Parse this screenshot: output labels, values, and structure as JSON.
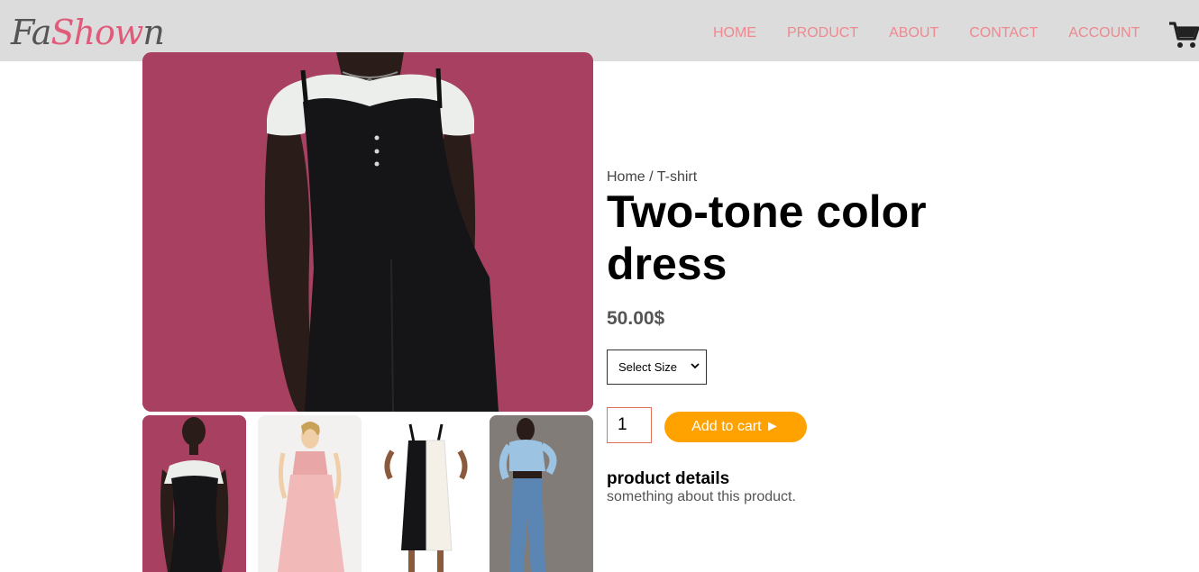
{
  "brand": {
    "logo_part1": "Fa",
    "logo_part2": "Show",
    "logo_part3": "n",
    "accent_color": "#e05a7a"
  },
  "nav": {
    "items": [
      "HOME",
      "PRODUCT",
      "ABOUT",
      "CONTACT",
      "ACCOUNT"
    ],
    "link_color": "#f0888f",
    "cart_icon": "shopping-cart-icon"
  },
  "product": {
    "breadcrumb": "Home / T-shirt",
    "title": "Two-tone color dress",
    "price": "50.00$",
    "size_select": {
      "selected": "Select Size"
    },
    "quantity": "1",
    "add_to_cart_label": "Add to cart ►",
    "button_color": "#ffa200",
    "details_heading": "product details",
    "details_text": "something about this product."
  },
  "gallery": {
    "main_image": "model-black-dress-photo",
    "thumbnails": [
      "black-dress-thumb",
      "pink-dress-thumb",
      "two-tone-dress-thumb",
      "blue-outfit-thumb"
    ]
  }
}
